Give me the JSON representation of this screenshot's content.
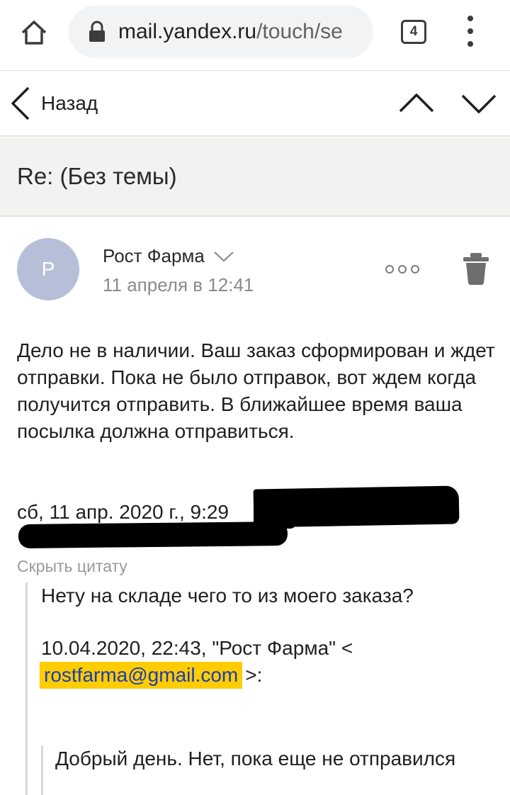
{
  "browser": {
    "url_host": "mail.yandex.ru",
    "url_path": "/touch/se",
    "tab_count": "4"
  },
  "nav": {
    "back_label": "Назад"
  },
  "message": {
    "subject": "Re: (Без темы)",
    "avatar_letter": "Р",
    "sender_name": "Рост Фарма",
    "date": "11 апреля в 12:41",
    "body": "Дело не в наличии. Ваш заказ сформирован и ждет отправки. Пока не было отправок, вот ждем когда получится отправить. В ближайшее время ваша посылка должна отправиться.",
    "reply_header": "сб, 11 апр. 2020 г., 9:29",
    "hide_quote_label": "Скрыть цитату"
  },
  "quote": {
    "text": "Нету на складе чего то из моего заказа?",
    "header_prefix": "10.04.2020, 22:43, \"Рост Фарма\" <",
    "email": "rostfarma@gmail.com",
    "header_suffix": ">:",
    "nested_text": "Добрый день. Нет, пока еще не отправился"
  },
  "icons": {
    "home": "home-icon",
    "lock": "lock-icon",
    "menu": "more-vert-icon",
    "back": "chevron-left-icon",
    "prev": "chevron-up-icon",
    "next": "chevron-down-icon",
    "sender_details": "chevron-down-icon",
    "more": "more-horiz-icon",
    "trash": "trash-icon"
  },
  "colors": {
    "avatar": "#b7bfd8",
    "highlight": "#ffcc00",
    "link": "#1a3cb8",
    "subject_bg": "#f2f2f0"
  }
}
